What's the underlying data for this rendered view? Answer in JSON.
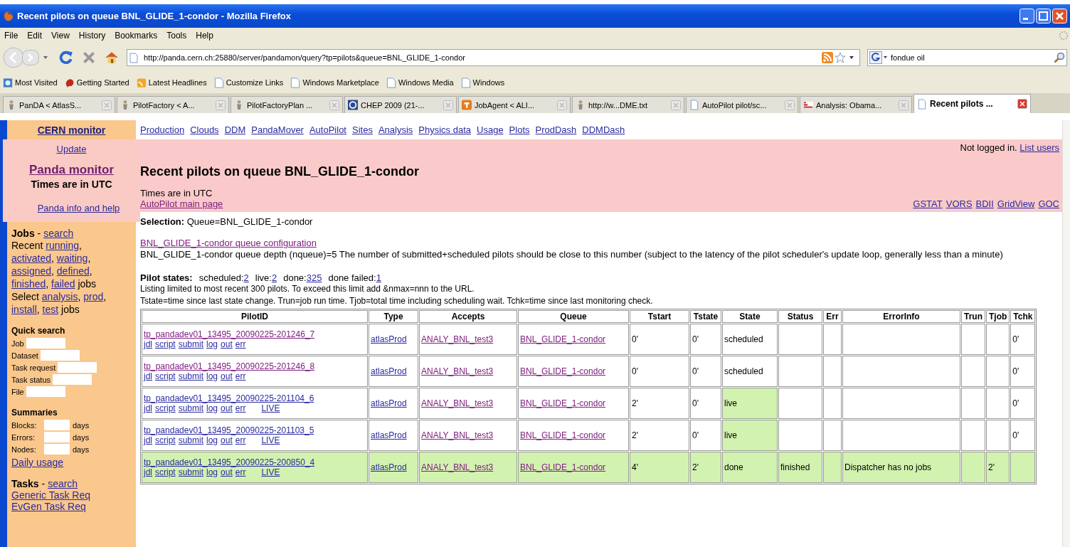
{
  "window": {
    "title": "Recent pilots on queue BNL_GLIDE_1-condor - Mozilla Firefox"
  },
  "menu": [
    "File",
    "Edit",
    "View",
    "History",
    "Bookmarks",
    "Tools",
    "Help"
  ],
  "address": {
    "value": "http://panda.cern.ch:25880/server/pandamon/query?tp=pilots&queue=BNL_GLIDE_1-condor"
  },
  "search": {
    "value": "fondue oil"
  },
  "bookmarks": [
    {
      "label": "Most Visited",
      "kind": "globe"
    },
    {
      "label": "Getting Started",
      "kind": "firefox"
    },
    {
      "label": "Latest Headlines",
      "kind": "rss"
    },
    {
      "label": "Customize Links",
      "kind": "page"
    },
    {
      "label": "Windows Marketplace",
      "kind": "page"
    },
    {
      "label": "Windows Media",
      "kind": "page"
    },
    {
      "label": "Windows",
      "kind": "page"
    }
  ],
  "tabs": [
    {
      "label": "PanDA < AtlasS...",
      "kind": "person",
      "selected": false
    },
    {
      "label": "PilotFactory < A...",
      "kind": "person",
      "selected": false
    },
    {
      "label": "PilotFactoryPlan ...",
      "kind": "person",
      "selected": false
    },
    {
      "label": "CHEP 2009 (21-...",
      "kind": "chep",
      "selected": false
    },
    {
      "label": "JobAgent < ALI...",
      "kind": "orange",
      "selected": false
    },
    {
      "label": "http://w...DME.txt",
      "kind": "person",
      "selected": false
    },
    {
      "label": "AutoPilot pilot/sc...",
      "kind": "page",
      "selected": false
    },
    {
      "label": "Analysis: Obama...",
      "kind": "news",
      "selected": false
    },
    {
      "label": "Recent pilots ...",
      "kind": "page",
      "selected": true
    }
  ],
  "sidebar": {
    "title": "CERN monitor",
    "update": "Update",
    "brand": "Panda monitor",
    "times": "Times are in UTC",
    "help": "Panda info and help",
    "jobs": {
      "heading": "Jobs",
      "dash": "-",
      "link": "search",
      "paragraphs": [
        [
          {
            "kind": "text",
            "text": "Recent "
          },
          {
            "kind": "link",
            "text": "running"
          },
          {
            "kind": "text",
            "text": ", "
          },
          {
            "kind": "link",
            "text": "activated"
          },
          {
            "kind": "text",
            "text": ", "
          },
          {
            "kind": "link",
            "text": "waiting"
          },
          {
            "kind": "text",
            "text": ", "
          },
          {
            "kind": "link",
            "text": "assigned"
          },
          {
            "kind": "text",
            "text": ", "
          },
          {
            "kind": "link",
            "text": "defined"
          },
          {
            "kind": "text",
            "text": ", "
          },
          {
            "kind": "link",
            "text": "finished"
          },
          {
            "kind": "text",
            "text": ", "
          },
          {
            "kind": "link",
            "text": "failed"
          },
          {
            "kind": "text",
            "text": " jobs"
          }
        ],
        [
          {
            "kind": "text",
            "text": "Select "
          },
          {
            "kind": "link",
            "text": "analysis"
          },
          {
            "kind": "text",
            "text": ", "
          },
          {
            "kind": "link",
            "text": "prod"
          },
          {
            "kind": "text",
            "text": ", "
          },
          {
            "kind": "link",
            "text": "install"
          },
          {
            "kind": "text",
            "text": ", "
          },
          {
            "kind": "link",
            "text": "test"
          },
          {
            "kind": "text",
            "text": " jobs"
          }
        ]
      ]
    },
    "quick_search": {
      "heading": "Quick search",
      "fields": [
        {
          "label": "Job"
        },
        {
          "label": "Dataset"
        },
        {
          "label": "Task request"
        },
        {
          "label": "Task status"
        },
        {
          "label": "File"
        }
      ]
    },
    "summaries": {
      "heading": "Summaries",
      "rows": [
        {
          "label": "Blocks:",
          "unit": "days"
        },
        {
          "label": "Errors:",
          "unit": "days"
        },
        {
          "label": "Nodes:",
          "unit": "days"
        }
      ],
      "link": "Daily usage"
    },
    "tasks": {
      "heading": "Tasks",
      "dash": "-",
      "link": "search",
      "links": [
        "Generic Task Req",
        "EvGen Task Req"
      ]
    }
  },
  "nav": [
    "Production",
    "Clouds",
    "DDM",
    "PandaMover",
    "AutoPilot",
    "Sites",
    "Analysis",
    "Physics data",
    "Usage",
    "Plots",
    "ProdDash",
    "DDMDash"
  ],
  "header": {
    "login": "Not logged in.",
    "login_link": "List users",
    "title": "Recent pilots on queue BNL_GLIDE_1-condor",
    "times": "Times are in UTC",
    "main_link": "AutoPilot main page",
    "grid_links": [
      "GSTAT",
      "VORS",
      "BDII",
      "GridView",
      "GOC"
    ]
  },
  "selection": {
    "label": "Selection:",
    "value": "Queue=BNL_GLIDE_1-condor"
  },
  "config_link": "BNL_GLIDE_1-condor queue configuration",
  "depth": "BNL_GLIDE_1-condor queue depth (nqueue)=5   The number of submitted+scheduled pilots should be close to this number (subject to the latency of the pilot scheduler's update loop, generally less than a minute)",
  "pilot_states": {
    "label": "Pilot states:",
    "items": [
      {
        "label": "scheduled:",
        "count": "2"
      },
      {
        "label": "live:",
        "count": "2"
      },
      {
        "label": "done:",
        "count": "325"
      },
      {
        "label": "done failed:",
        "count": "1"
      }
    ]
  },
  "notes": [
    "Listing limited to most recent 300 pilots. To exceed this limit add &nmax=nnn to the URL.",
    "Tstate=time since last state change. Trun=job run time. Tjob=total time including scheduling wait. Tchk=time since last monitoring check."
  ],
  "table": {
    "columns": [
      "PilotID",
      "Type",
      "Accepts",
      "Queue",
      "Tstart",
      "Tstate",
      "State",
      "Status",
      "Err",
      "ErrorInfo",
      "Trun",
      "Tjob",
      "Tchk"
    ],
    "rows": [
      {
        "kind": "scheduled",
        "pilot": "tp_pandadev01_13495_20090225-201246_7",
        "actions": [
          "jdl",
          "script",
          "submit",
          "log",
          "out",
          "err"
        ],
        "type": "atlasProd",
        "accepts": "ANALY_BNL_test3",
        "queue": "BNL_GLIDE_1-condor",
        "tstart": "0'",
        "tstate": "0'",
        "state": "scheduled",
        "tchk": "0'"
      },
      {
        "kind": "scheduled",
        "pilot": "tp_pandadev01_13495_20090225-201246_8",
        "actions": [
          "jdl",
          "script",
          "submit",
          "log",
          "out",
          "err"
        ],
        "type": "atlasProd",
        "accepts": "ANALY_BNL_test3",
        "queue": "BNL_GLIDE_1-condor",
        "tstart": "0'",
        "tstate": "0'",
        "state": "scheduled",
        "tchk": "0'"
      },
      {
        "kind": "live",
        "pilot": "tp_pandadev01_13495_20090225-201104_6",
        "actions": [
          "jdl",
          "script",
          "submit",
          "log",
          "out",
          "err"
        ],
        "live_link": "LIVE",
        "type": "atlasProd",
        "accepts": "ANALY_BNL_test3",
        "queue": "BNL_GLIDE_1-condor",
        "tstart": "2'",
        "tstate": "0'",
        "state": "live",
        "tchk": "0'"
      },
      {
        "kind": "live",
        "pilot": "tp_pandadev01_13495_20090225-201103_5",
        "actions": [
          "jdl",
          "script",
          "submit",
          "log",
          "out",
          "err"
        ],
        "live_link": "LIVE",
        "type": "atlasProd",
        "accepts": "ANALY_BNL_test3",
        "queue": "BNL_GLIDE_1-condor",
        "tstart": "2'",
        "tstate": "0'",
        "state": "live",
        "tchk": "0'"
      },
      {
        "kind": "done",
        "pilot": "tp_pandadev01_13495_20090225-200850_4",
        "actions": [
          "jdl",
          "script",
          "submit",
          "log",
          "out",
          "err"
        ],
        "live_link": "LIVE",
        "type": "atlasProd",
        "accepts": "ANALY_BNL_test3",
        "queue": "BNL_GLIDE_1-condor",
        "tstart": "4'",
        "tstate": "2'",
        "state": "done",
        "status": "finished",
        "errorinfo": "Dispatcher has no jobs",
        "tjob": "2'"
      }
    ]
  }
}
